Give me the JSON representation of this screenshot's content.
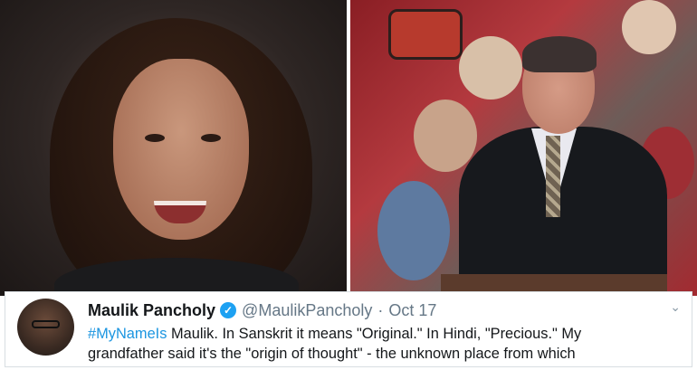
{
  "tweet": {
    "display_name": "Maulik Pancholy",
    "handle": "@MaulikPancholy",
    "separator": "·",
    "date": "Oct 17",
    "hashtag": "#MyNameIs",
    "line1_rest": " Maulik. In Sanskrit it means \"Original.\" In Hindi, \"Precious.\" My",
    "line2": "grandfather said it's the \"origin of thought\" - the unknown place from which",
    "verified_icon": "verified-badge-icon",
    "verified_glyph": "✓",
    "menu_icon": "chevron-down-icon",
    "menu_glyph": "⌄"
  },
  "colors": {
    "link": "#1b95e0",
    "verified": "#1da1f2",
    "muted": "#657786"
  }
}
